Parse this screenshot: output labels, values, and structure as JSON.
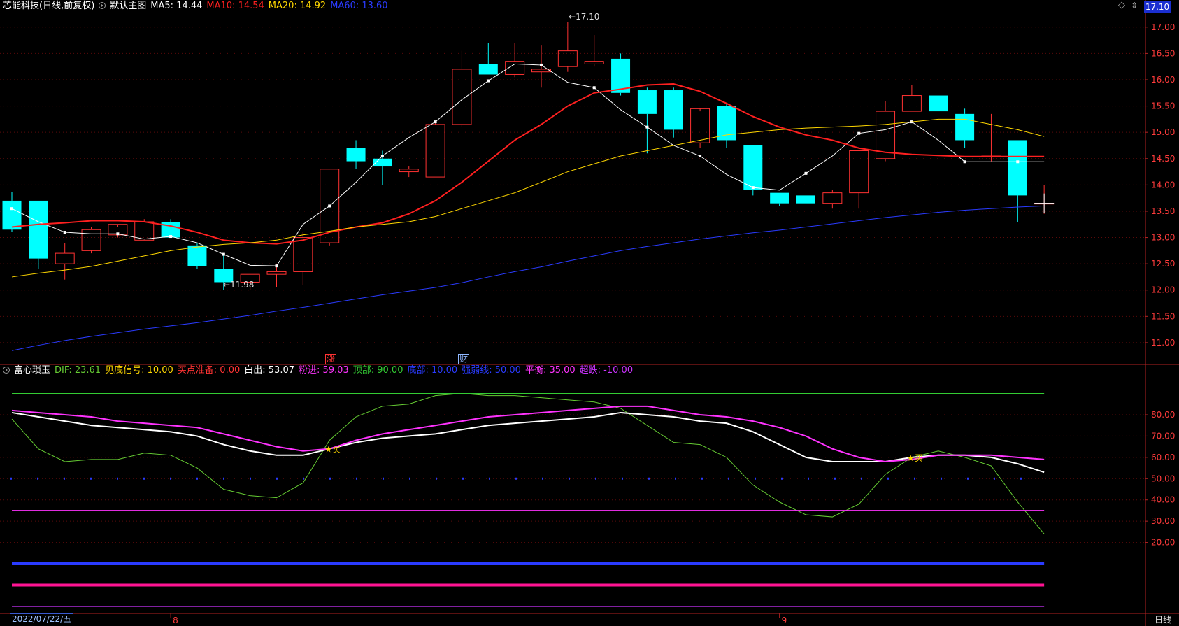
{
  "header_top": {
    "stock": "芯能科技(日线,前复权)",
    "panel": "默认主图",
    "items": [
      {
        "text": "MA5: 14.44",
        "color": "#ffffff"
      },
      {
        "text": "MA10: 14.54",
        "color": "#ff2020"
      },
      {
        "text": "MA20: 14.92",
        "color": "#ffd700"
      },
      {
        "text": "MA60: 13.60",
        "color": "#2a3bff"
      }
    ]
  },
  "header_ind": {
    "name": "富心琐玉",
    "items": [
      {
        "text": "DIF: 23.61",
        "color": "#66cc33"
      },
      {
        "text": "见底信号: 10.00",
        "color": "#ffd700"
      },
      {
        "text": "买点准备: 0.00",
        "color": "#ff3333"
      },
      {
        "text": "白出: 53.07",
        "color": "#ffffff"
      },
      {
        "text": "粉进: 59.03",
        "color": "#ff33ff"
      },
      {
        "text": "顶部: 90.00",
        "color": "#33cc33"
      },
      {
        "text": "底部: 10.00",
        "color": "#2a3bff"
      },
      {
        "text": "强弱线: 50.00",
        "color": "#2a3bff"
      },
      {
        "text": "平衡: 35.00",
        "color": "#ff33ff"
      },
      {
        "text": "超跌: -10.00",
        "color": "#cc33ff"
      }
    ]
  },
  "price_box": "17.10",
  "icons": {
    "panel": "play-circle-icon",
    "diamond": "diamond-icon",
    "updown": "updown-icon"
  },
  "date_label": "2022/07/22/五",
  "period_label": "日线",
  "events": {
    "zhang": "涨",
    "cai": "财"
  },
  "hi_label": "17.10",
  "lo_label": "11.98",
  "chart_data": [
    {
      "type": "candlestick",
      "yaxis_ticks": [
        "17.00",
        "16.50",
        "16.00",
        "15.50",
        "15.00",
        "14.50",
        "14.00",
        "13.50",
        "13.00",
        "12.50",
        "12.00",
        "11.50",
        "11.00"
      ],
      "ylim": [
        10.6,
        17.25
      ],
      "x_labels": [
        {
          "index": 6,
          "text": "8"
        },
        {
          "index": 29,
          "text": "9"
        }
      ],
      "candles": [
        {
          "o": 13.7,
          "h": 13.86,
          "l": 13.1,
          "c": 13.15
        },
        {
          "o": 13.7,
          "h": 13.7,
          "l": 12.4,
          "c": 12.6
        },
        {
          "o": 12.5,
          "h": 12.9,
          "l": 12.2,
          "c": 12.7
        },
        {
          "o": 12.75,
          "h": 13.2,
          "l": 12.7,
          "c": 13.15
        },
        {
          "o": 13.05,
          "h": 13.2,
          "l": 13.0,
          "c": 13.25
        },
        {
          "o": 12.95,
          "h": 13.35,
          "l": 12.95,
          "c": 13.3
        },
        {
          "o": 13.3,
          "h": 13.35,
          "l": 13.0,
          "c": 13.0
        },
        {
          "o": 12.85,
          "h": 12.9,
          "l": 12.4,
          "c": 12.45
        },
        {
          "o": 12.4,
          "h": 12.7,
          "l": 12.0,
          "c": 12.15
        },
        {
          "o": 12.15,
          "h": 12.3,
          "l": 12.0,
          "c": 12.3
        },
        {
          "o": 12.3,
          "h": 12.5,
          "l": 12.05,
          "c": 12.35
        },
        {
          "o": 12.35,
          "h": 13.1,
          "l": 12.1,
          "c": 13.0
        },
        {
          "o": 12.9,
          "h": 14.3,
          "l": 12.85,
          "c": 14.3
        },
        {
          "o": 14.7,
          "h": 14.85,
          "l": 14.3,
          "c": 14.45
        },
        {
          "o": 14.5,
          "h": 14.65,
          "l": 14.0,
          "c": 14.35
        },
        {
          "o": 14.25,
          "h": 14.35,
          "l": 14.15,
          "c": 14.3
        },
        {
          "o": 14.15,
          "h": 15.2,
          "l": 14.15,
          "c": 15.15
        },
        {
          "o": 15.15,
          "h": 16.55,
          "l": 15.1,
          "c": 16.2
        },
        {
          "o": 16.3,
          "h": 16.7,
          "l": 16.1,
          "c": 16.1
        },
        {
          "o": 16.1,
          "h": 16.7,
          "l": 16.05,
          "c": 16.35
        },
        {
          "o": 16.15,
          "h": 16.65,
          "l": 15.85,
          "c": 16.2
        },
        {
          "o": 16.25,
          "h": 17.1,
          "l": 16.15,
          "c": 16.55
        },
        {
          "o": 16.3,
          "h": 16.85,
          "l": 16.25,
          "c": 16.35
        },
        {
          "o": 16.4,
          "h": 16.5,
          "l": 15.7,
          "c": 15.75
        },
        {
          "o": 15.8,
          "h": 15.85,
          "l": 14.6,
          "c": 15.35
        },
        {
          "o": 15.8,
          "h": 15.85,
          "l": 14.9,
          "c": 15.05
        },
        {
          "o": 14.8,
          "h": 15.4,
          "l": 14.7,
          "c": 15.45
        },
        {
          "o": 15.5,
          "h": 15.55,
          "l": 14.7,
          "c": 14.85
        },
        {
          "o": 14.75,
          "h": 14.75,
          "l": 13.8,
          "c": 13.9
        },
        {
          "o": 13.85,
          "h": 13.85,
          "l": 13.6,
          "c": 13.65
        },
        {
          "o": 13.8,
          "h": 14.05,
          "l": 13.5,
          "c": 13.65
        },
        {
          "o": 13.65,
          "h": 13.9,
          "l": 13.55,
          "c": 13.85
        },
        {
          "o": 13.85,
          "h": 14.65,
          "l": 13.55,
          "c": 14.65
        },
        {
          "o": 14.5,
          "h": 15.6,
          "l": 14.45,
          "c": 15.4
        },
        {
          "o": 15.4,
          "h": 15.9,
          "l": 15.4,
          "c": 15.7
        },
        {
          "o": 15.7,
          "h": 15.7,
          "l": 15.4,
          "c": 15.4
        },
        {
          "o": 15.35,
          "h": 15.45,
          "l": 14.7,
          "c": 14.85
        },
        {
          "o": 14.55,
          "h": 15.35,
          "l": 14.45,
          "c": 14.55
        },
        {
          "o": 14.85,
          "h": 14.85,
          "l": 13.3,
          "c": 13.8
        },
        {
          "o": 13.65,
          "h": 14.0,
          "l": 13.45,
          "c": 13.65
        }
      ],
      "series": [
        {
          "name": "MA5",
          "color": "#ffffff",
          "values": [
            13.55,
            13.3,
            13.1,
            13.07,
            13.07,
            12.97,
            13.02,
            12.9,
            12.68,
            12.47,
            12.46,
            13.25,
            13.6,
            14.05,
            14.55,
            14.9,
            15.2,
            15.62,
            15.98,
            16.3,
            16.28,
            15.95,
            15.85,
            15.43,
            15.1,
            14.75,
            14.55,
            14.2,
            13.95,
            13.9,
            14.22,
            14.55,
            14.98,
            15.05,
            15.2,
            14.85,
            14.44,
            14.44,
            14.44,
            14.44
          ]
        },
        {
          "name": "MA10",
          "color": "#ff2020",
          "values": [
            13.2,
            13.25,
            13.28,
            13.32,
            13.32,
            13.3,
            13.22,
            13.1,
            12.95,
            12.9,
            12.88,
            12.95,
            13.1,
            13.2,
            13.28,
            13.45,
            13.7,
            14.05,
            14.45,
            14.85,
            15.15,
            15.5,
            15.75,
            15.82,
            15.9,
            15.92,
            15.78,
            15.55,
            15.3,
            15.1,
            14.95,
            14.85,
            14.7,
            14.62,
            14.58,
            14.56,
            14.54,
            14.54,
            14.54,
            14.54
          ]
        },
        {
          "name": "MA20",
          "color": "#ffd700",
          "values": [
            12.25,
            12.32,
            12.38,
            12.45,
            12.55,
            12.65,
            12.75,
            12.82,
            12.87,
            12.9,
            12.95,
            13.05,
            13.12,
            13.2,
            13.25,
            13.3,
            13.4,
            13.55,
            13.7,
            13.85,
            14.05,
            14.25,
            14.4,
            14.55,
            14.65,
            14.75,
            14.85,
            14.95,
            15.0,
            15.05,
            15.08,
            15.1,
            15.12,
            15.15,
            15.2,
            15.25,
            15.25,
            15.15,
            15.05,
            14.92
          ]
        },
        {
          "name": "MA60",
          "color": "#2a3bff",
          "values": [
            10.85,
            10.95,
            11.04,
            11.12,
            11.19,
            11.26,
            11.32,
            11.38,
            11.45,
            11.52,
            11.6,
            11.67,
            11.75,
            11.83,
            11.91,
            11.98,
            12.05,
            12.14,
            12.25,
            12.35,
            12.44,
            12.55,
            12.65,
            12.75,
            12.83,
            12.9,
            12.97,
            13.03,
            13.09,
            13.14,
            13.2,
            13.26,
            13.32,
            13.38,
            13.43,
            13.48,
            13.52,
            13.55,
            13.58,
            13.6
          ]
        }
      ],
      "annotations": [
        {
          "index": 21,
          "text": "17.10",
          "kind": "high"
        },
        {
          "index": 8,
          "text": "11.98",
          "kind": "low"
        }
      ]
    },
    {
      "type": "line",
      "title": "富心琐玉",
      "yaxis_ticks": [
        "80.00",
        "70.00",
        "60.00",
        "50.00",
        "40.00",
        "30.00",
        "20.00"
      ],
      "ylim": [
        -13,
        103
      ],
      "series": [
        {
          "name": "DIF",
          "color": "#66cc33",
          "values": [
            78,
            64,
            58,
            59,
            59,
            62,
            61,
            55,
            45,
            42,
            41,
            48,
            68,
            79,
            84,
            85,
            89,
            90,
            89,
            89,
            88,
            87,
            86,
            83,
            75,
            67,
            66,
            60,
            47,
            39,
            33,
            32,
            38,
            52,
            60,
            63,
            60,
            56,
            39,
            24
          ]
        },
        {
          "name": "白出",
          "color": "#ffffff",
          "values": [
            81,
            79,
            77,
            75,
            74,
            73,
            72,
            70,
            66,
            63,
            61,
            61,
            64,
            67,
            69,
            70,
            71,
            73,
            75,
            76,
            77,
            78,
            79,
            81,
            80,
            79,
            77,
            76,
            72,
            66,
            60,
            58,
            58,
            58,
            60,
            61,
            61,
            60,
            57,
            53
          ]
        },
        {
          "name": "粉进",
          "color": "#ff33ff",
          "values": [
            82,
            81,
            80,
            79,
            77,
            76,
            75,
            74,
            71,
            68,
            65,
            63,
            64,
            68,
            71,
            73,
            75,
            77,
            79,
            80,
            81,
            82,
            83,
            84,
            84,
            82,
            80,
            79,
            77,
            74,
            70,
            64,
            60,
            58,
            59,
            61,
            61,
            61,
            60,
            59
          ]
        },
        {
          "name": "顶部",
          "color": "#33cc33",
          "values": [
            90
          ]
        },
        {
          "name": "强弱线",
          "color": "#2a3bff",
          "values": [
            50
          ]
        },
        {
          "name": "平衡",
          "color": "#ff33ff",
          "values": [
            35
          ]
        },
        {
          "name": "底部",
          "color": "#2a3bff",
          "values": [
            10
          ]
        },
        {
          "name": "超跌",
          "color": "#cc33ff",
          "values": [
            -10
          ]
        }
      ],
      "buy_signals": [
        {
          "index": 12,
          "text": "买"
        },
        {
          "index": 34,
          "text": "买"
        }
      ],
      "star_marks": [
        {
          "index": 12
        },
        {
          "index": 34
        }
      ]
    }
  ]
}
